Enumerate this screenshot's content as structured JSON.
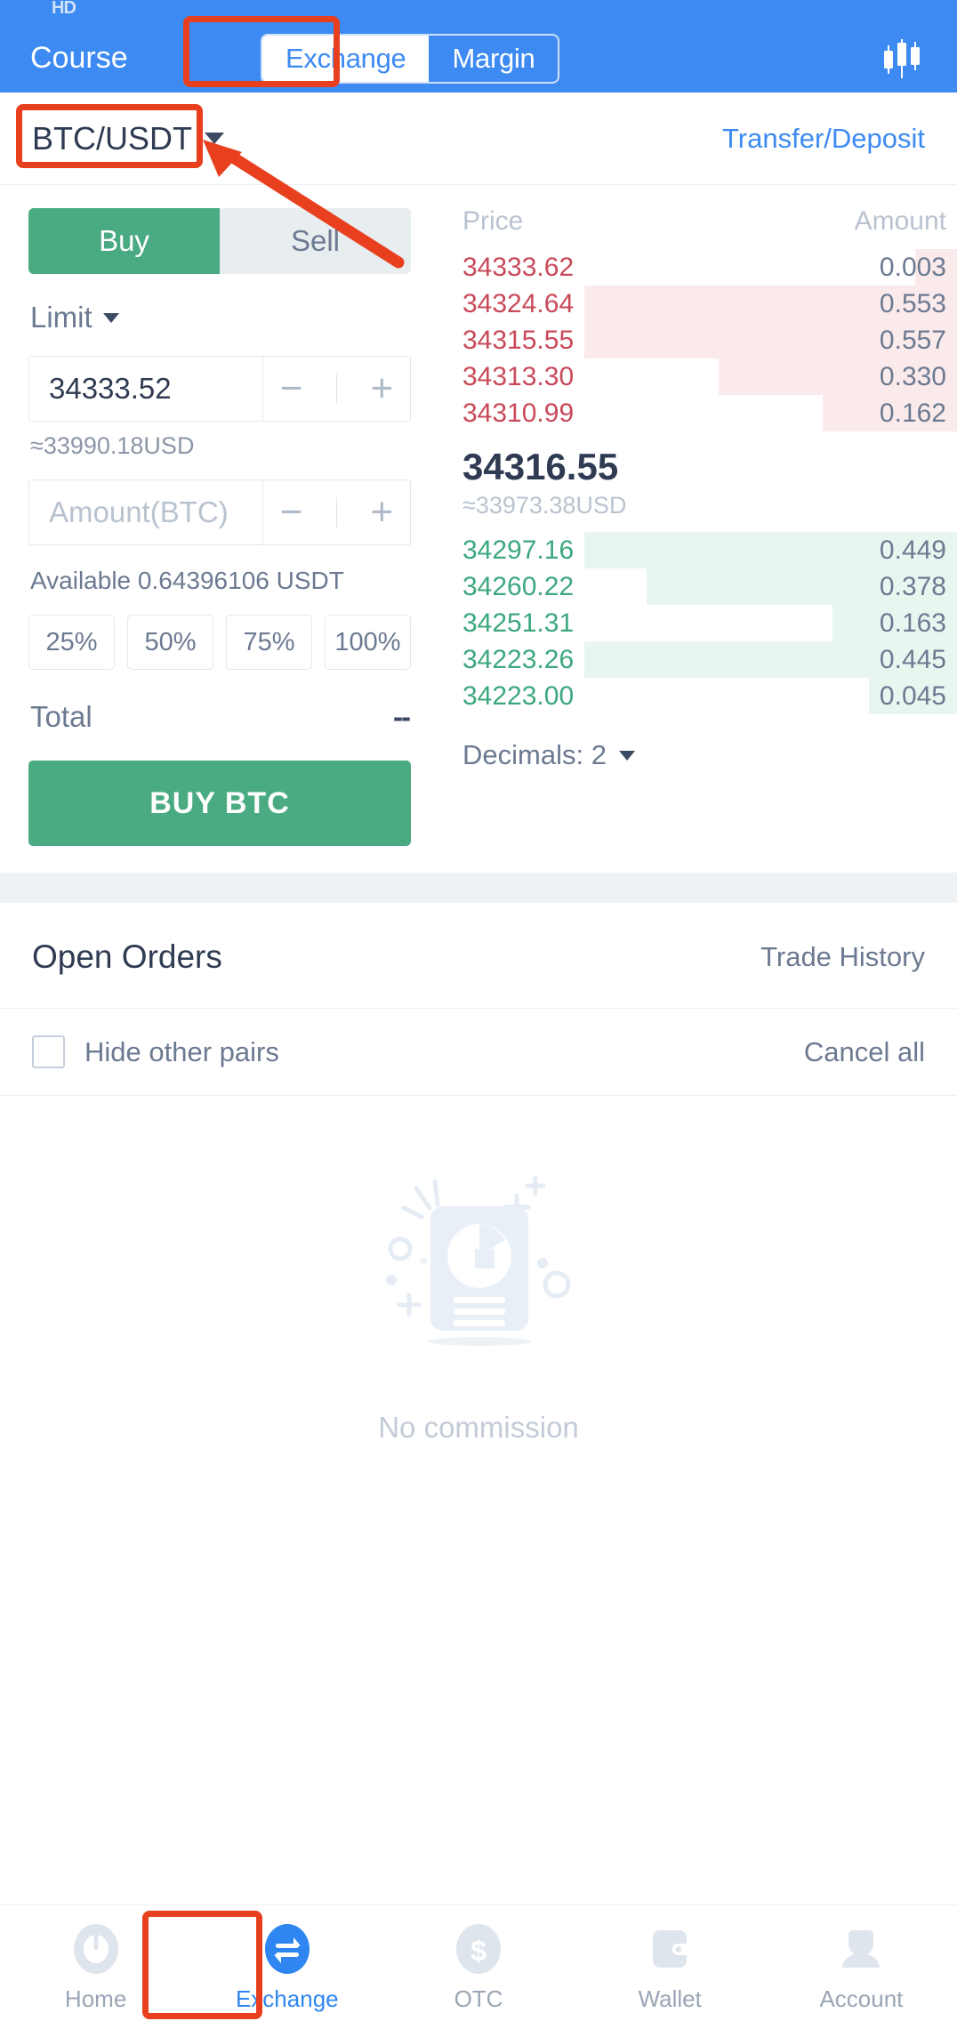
{
  "statusbar": {
    "icon_label": "HD"
  },
  "header": {
    "course_label": "Course",
    "tabs": [
      {
        "label": "Exchange",
        "active": true
      },
      {
        "label": "Margin",
        "active": false
      }
    ],
    "chart_icon": "candlestick-chart-icon",
    "accent": "#3d8bf2"
  },
  "pairbar": {
    "pair": "BTC/USDT",
    "dropdown_icon": "chevron-down-icon",
    "transfer_deposit_label": "Transfer/Deposit"
  },
  "order_form": {
    "side_tabs": [
      {
        "label": "Buy",
        "active": true
      },
      {
        "label": "Sell",
        "active": false
      }
    ],
    "order_type": "Limit",
    "price_value": "34333.52",
    "price_approx": "≈33990.18USD",
    "amount_placeholder": "Amount(BTC)",
    "amount_value": "",
    "available_label": "Available",
    "available_value": "0.64396106 USDT",
    "percents": [
      "25%",
      "50%",
      "75%",
      "100%"
    ],
    "total_label": "Total",
    "total_value": "--",
    "submit_label": "BUY BTC",
    "buy_color": "#4aaa82",
    "minus_icon": "minus-icon",
    "plus_icon": "plus-icon"
  },
  "orderbook": {
    "col_price": "Price",
    "col_amount": "Amount",
    "asks": [
      {
        "price": "34333.62",
        "amount": "0.003",
        "depth": 8
      },
      {
        "price": "34324.64",
        "amount": "0.553",
        "depth": 72
      },
      {
        "price": "34315.55",
        "amount": "0.557",
        "depth": 72
      },
      {
        "price": "34313.30",
        "amount": "0.330",
        "depth": 46
      },
      {
        "price": "34310.99",
        "amount": "0.162",
        "depth": 26
      }
    ],
    "mid_price": "34316.55",
    "mid_approx": "≈33973.38USD",
    "bids": [
      {
        "price": "34297.16",
        "amount": "0.449",
        "depth": 72
      },
      {
        "price": "34260.22",
        "amount": "0.378",
        "depth": 60
      },
      {
        "price": "34251.31",
        "amount": "0.163",
        "depth": 24
      },
      {
        "price": "34223.26",
        "amount": "0.445",
        "depth": 72
      },
      {
        "price": "34223.00",
        "amount": "0.045",
        "depth": 17
      }
    ],
    "decimals_label": "Decimals: 2",
    "decimals_icon": "chevron-down-icon",
    "ask_color": "#c94a5a",
    "bid_color": "#3da87e"
  },
  "open_orders": {
    "title": "Open Orders",
    "trade_history_label": "Trade History",
    "hide_other_pairs_label": "Hide other pairs",
    "hide_other_pairs_checked": false,
    "cancel_all_label": "Cancel all",
    "empty_text": "No commission",
    "empty_icon": "empty-document-icon"
  },
  "bottom_nav": [
    {
      "label": "Home",
      "icon": "clock-icon",
      "active": false
    },
    {
      "label": "Exchange",
      "icon": "exchange-arrows-icon",
      "active": true
    },
    {
      "label": "OTC",
      "icon": "dollar-icon",
      "active": false
    },
    {
      "label": "Wallet",
      "icon": "wallet-icon",
      "active": false
    },
    {
      "label": "Account",
      "icon": "person-icon",
      "active": false
    }
  ],
  "annotations": {
    "highlight_color": "#e8401f",
    "boxes": [
      "exchange-tab",
      "pair-selector",
      "bottom-nav-exchange"
    ],
    "arrow": "pair-selector-arrow"
  }
}
